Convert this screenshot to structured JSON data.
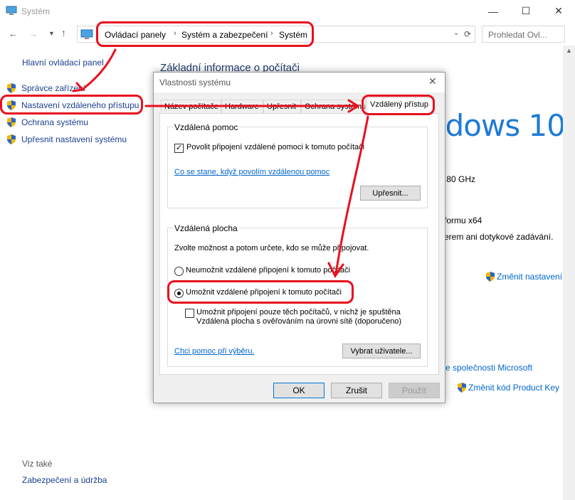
{
  "window": {
    "title": "Systém"
  },
  "nav": {
    "breadcrumbs": [
      "Ovládací panely",
      "Systém a zabezpečení",
      "Systém"
    ],
    "search_placeholder": "Prohledat Ovl..."
  },
  "sidebar": {
    "home": "Hlavní ovládací panel",
    "items": [
      {
        "label": "Správce zařízení"
      },
      {
        "label": "Nastavení vzdáleného přístupu"
      },
      {
        "label": "Ochrana systému"
      },
      {
        "label": "Upřesnit nastavení systému"
      }
    ],
    "see_also": "Viz také",
    "see_also_link": "Zabezpečení a údržba"
  },
  "main": {
    "heading": "Základní informace o počítači",
    "windows_logo": "ndows 10",
    "cpu_fragment": ".80 GHz",
    "platform_fragment": "formu x64",
    "touch_fragment": "erem ani dotykové zadávání.",
    "change_settings": "Změnit nastavení",
    "microsoft_fragment": "e společnosti Microsoft",
    "change_key": "Změnit kód Product Key"
  },
  "dialog": {
    "title": "Vlastnosti systému",
    "tabs": [
      "Název počítače",
      "Hardware",
      "Upřesnit",
      "Ochrana systému",
      "Vzdálený přístup"
    ],
    "remote_assistance": {
      "group": "Vzdálená pomoc",
      "allow": "Povolit připojení vzdálené pomoci k tomuto počítači",
      "help_link": "Co se stane, když povolím vzdálenou pomoc",
      "advanced": "Upřesnit..."
    },
    "remote_desktop": {
      "group": "Vzdálená plocha",
      "instruction": "Zvolte možnost a potom určete, kdo se může připojovat.",
      "option_deny": "Neumožnit vzdálené připojení k tomuto počítači",
      "option_allow": "Umožnit vzdálené připojení k tomuto počítači",
      "nla_line1": "Umožnit připojení pouze těch počítačů, v nichž je spuštěna",
      "nla_line2": "Vzdálená plocha s ověřováním na úrovni sítě (doporučeno)",
      "help_link": "Chci pomoc při výběru.",
      "select_users": "Vybrat uživatele..."
    },
    "buttons": {
      "ok": "OK",
      "cancel": "Zrušit",
      "apply": "Použít"
    }
  },
  "colors": {
    "annotation": "#e8101e",
    "link": "#0066cc",
    "accent": "#0078d7"
  }
}
